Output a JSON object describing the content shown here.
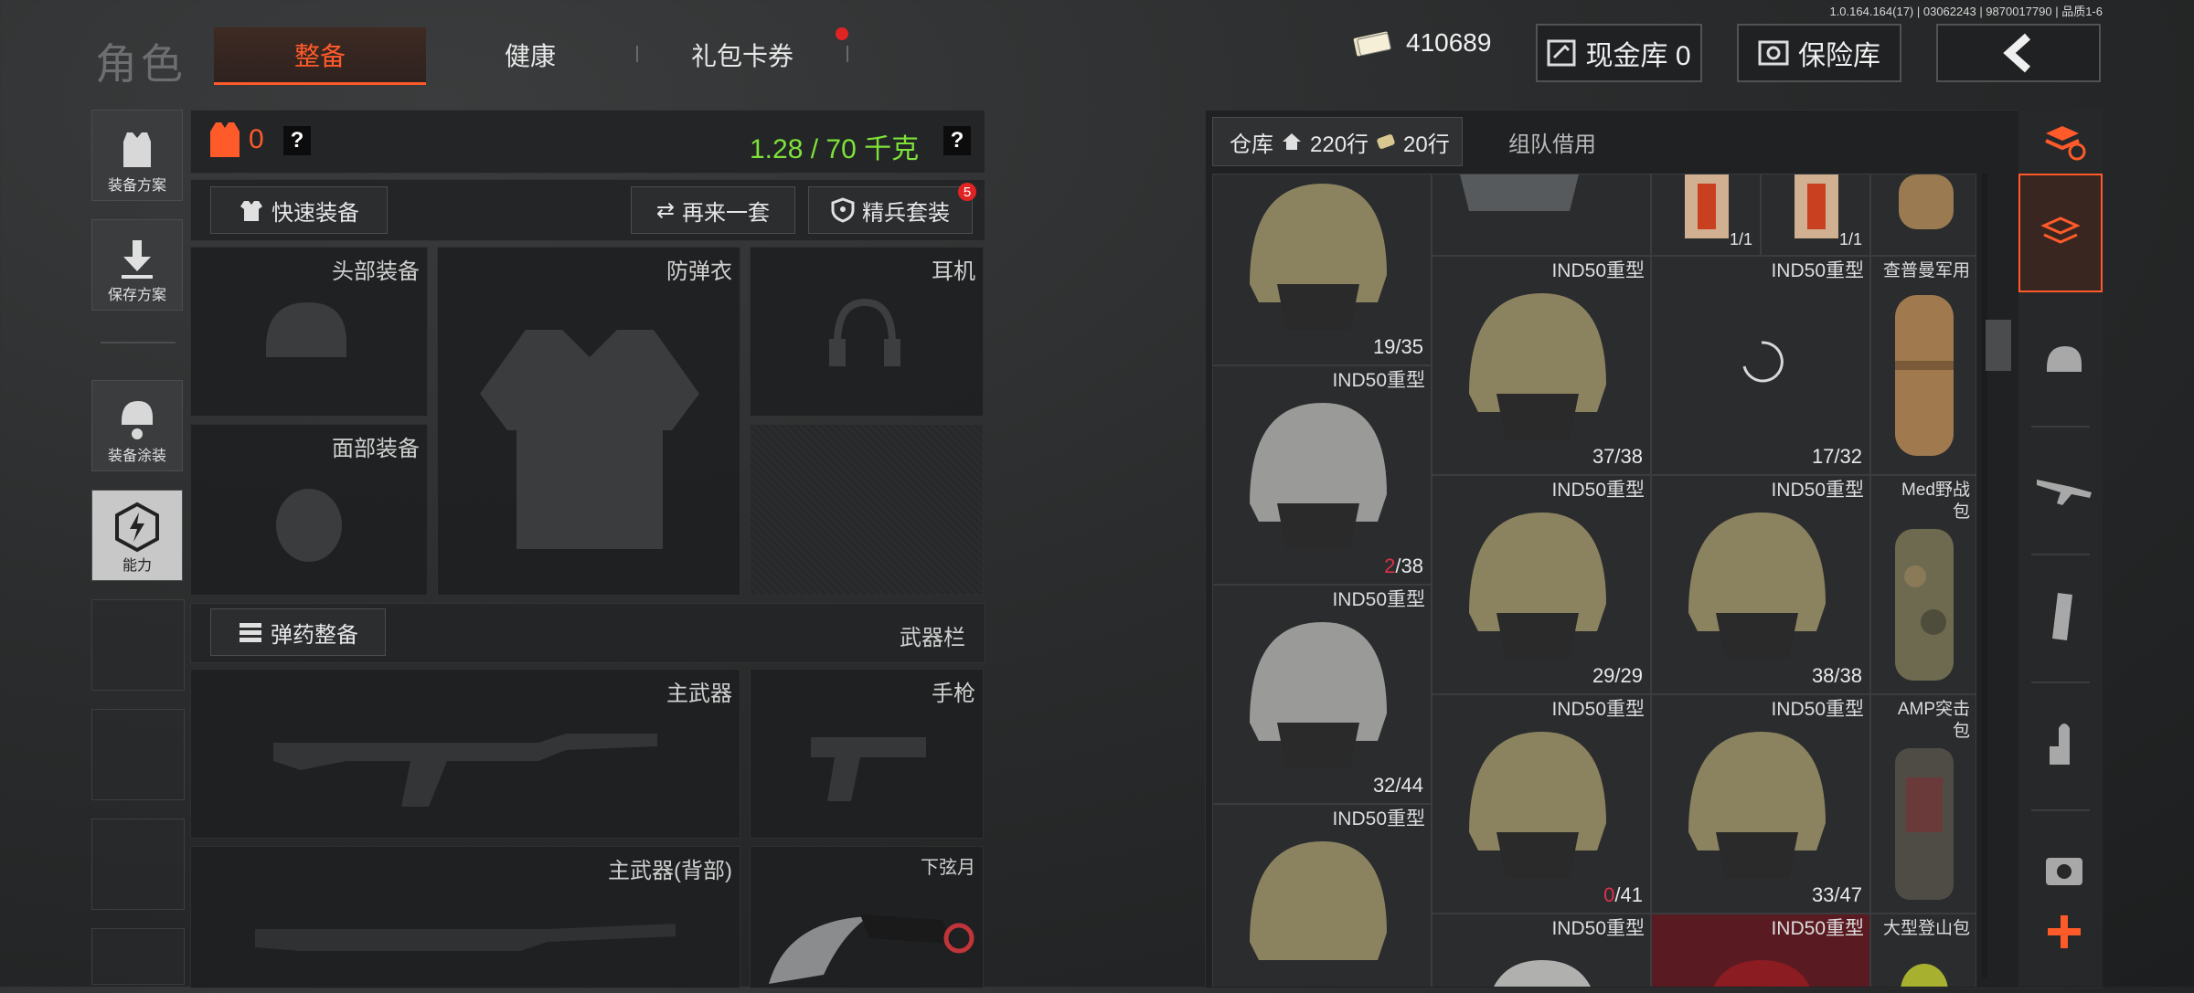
{
  "version": "1.0.164.164(17) | 03062243 | 9870017790 | 品质1-6",
  "title": "角色",
  "tabs": [
    {
      "label": "整备",
      "active": true
    },
    {
      "label": "健康",
      "active": false
    },
    {
      "label": "礼包卡券",
      "active": false,
      "notify": true
    }
  ],
  "top": {
    "money": "410689",
    "cash_vault": "现金库 0",
    "safe_box": "保险库"
  },
  "left_menu": [
    {
      "label": "装备方案",
      "icon": "vest-icon"
    },
    {
      "label": "保存方案",
      "icon": "download-icon"
    },
    {
      "label": "装备涂装",
      "icon": "helmet-paint-icon"
    },
    {
      "label": "能力",
      "icon": "ability-icon"
    }
  ],
  "equip": {
    "armor_count": "0",
    "weight": "1.28 / 70 千克",
    "quick_equip": "快速装备",
    "again": "再来一套",
    "elite": "精兵套装",
    "elite_badge": "5",
    "head": "头部装备",
    "vest": "防弹衣",
    "ear": "耳机",
    "face": "面部装备",
    "ammo": "弹药整备",
    "weapon_bar": "武器栏",
    "main": "主武器",
    "pistol": "手枪",
    "main_back": "主武器(背部)",
    "knife": "下弦月"
  },
  "warehouse": {
    "tab": "仓库",
    "rows1": "220行",
    "rows2": "20行",
    "team": "组队借用",
    "cells": [
      {
        "name": "",
        "count": "19/35"
      },
      {
        "name": "IND50重型",
        "count": "37/38"
      },
      {
        "name": "IND50重型",
        "count": "17/32"
      },
      {
        "name": "查普曼军用",
        "count": ""
      },
      {
        "name": "IND50重型",
        "count_red": "2",
        "count_rest": "/38"
      },
      {
        "name": "IND50重型",
        "count": "29/29"
      },
      {
        "name": "IND50重型",
        "count": "38/38"
      },
      {
        "name": "Med野战包",
        "count": ""
      },
      {
        "name": "IND50重型",
        "count": "32/44"
      },
      {
        "name": "IND50重型",
        "count_red": "0",
        "count_rest": "/41"
      },
      {
        "name": "IND50重型",
        "count": "33/47"
      },
      {
        "name": "AMP突击包",
        "count": ""
      },
      {
        "name": "IND50重型",
        "count": ""
      },
      {
        "name": "IND50重型",
        "count": ""
      },
      {
        "name": "IND50重型",
        "count": ""
      },
      {
        "name": "大型登山包",
        "count": ""
      }
    ],
    "top_counts": [
      "1/1",
      "1/1"
    ]
  },
  "colors": {
    "accent": "#ff5a2a",
    "weight": "#7ee23a",
    "red": "#e0304a"
  }
}
